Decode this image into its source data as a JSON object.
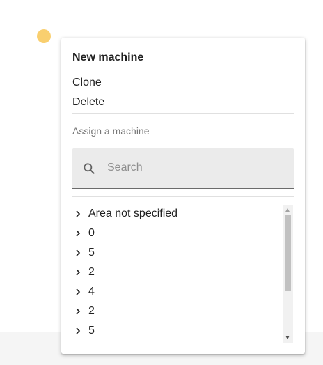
{
  "status_indicator": {
    "color": "#f9cf6f"
  },
  "menu": {
    "title": "New machine",
    "actions": {
      "clone": "Clone",
      "delete": "Delete"
    },
    "assign_section_label": "Assign a machine",
    "search": {
      "placeholder": "Search",
      "value": ""
    },
    "tree_items": [
      {
        "label": "Area not specified",
        "icon": "chevron-right-icon"
      },
      {
        "label": "0",
        "icon": "chevron-right-icon"
      },
      {
        "label": "5",
        "icon": "chevron-right-icon"
      },
      {
        "label": "2",
        "icon": "chevron-right-icon"
      },
      {
        "label": "4",
        "icon": "chevron-right-icon"
      },
      {
        "label": "2",
        "icon": "chevron-right-icon"
      },
      {
        "label": "5",
        "icon": "chevron-right-icon"
      }
    ]
  },
  "icons": {
    "search": "search-icon",
    "scroll_up": "scroll-up-arrow-icon",
    "scroll_down": "scroll-down-arrow-icon"
  }
}
